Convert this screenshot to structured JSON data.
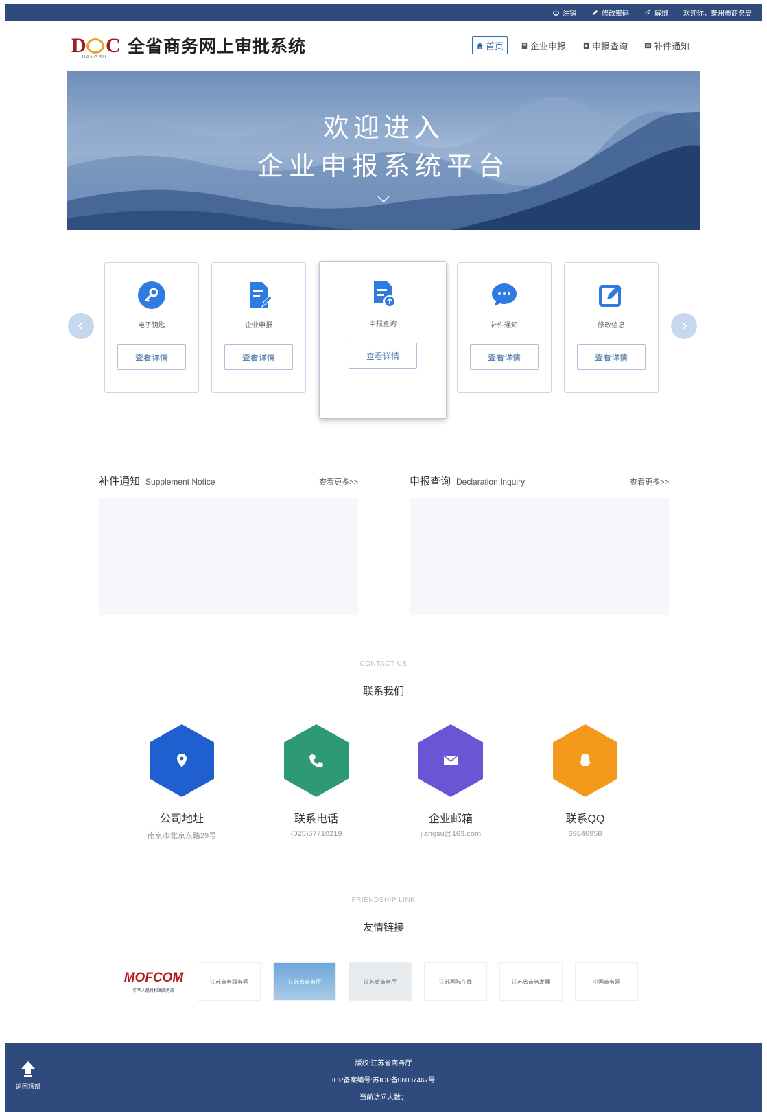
{
  "topbar": {
    "items": [
      {
        "label": "注销",
        "icon": "power-icon"
      },
      {
        "label": "修改密码",
        "icon": "pencil-icon"
      },
      {
        "label": "解绑",
        "icon": "unlink-icon"
      },
      {
        "label": "欢迎你，泰州市商务局",
        "icon": ""
      }
    ]
  },
  "header": {
    "logo_text": "DOC",
    "logo_sub": "JIANGSU",
    "title": "全省商务网上审批系统",
    "nav": [
      {
        "label": "首页",
        "icon": "home-icon",
        "active": true
      },
      {
        "label": "企业申报",
        "icon": "document-icon",
        "active": false
      },
      {
        "label": "申报查询",
        "icon": "search-document-icon",
        "active": false
      },
      {
        "label": "补件通知",
        "icon": "notice-icon",
        "active": false
      }
    ]
  },
  "banner": {
    "line1": "欢迎进入",
    "line2": "企业申报系统平台"
  },
  "cards": [
    {
      "label": "电子钥匙",
      "button": "查看详情",
      "icon": "key-icon"
    },
    {
      "label": "企业申报",
      "button": "查看详情",
      "icon": "edit-document-icon"
    },
    {
      "label": "申报查询",
      "button": "查看详情",
      "icon": "upload-document-icon"
    },
    {
      "label": "补件通知",
      "button": "查看详情",
      "icon": "chat-icon"
    },
    {
      "label": "修改信息",
      "button": "查看详情",
      "icon": "edit-icon"
    }
  ],
  "panels": [
    {
      "title": "补件通知",
      "subtitle": "Supplement Notice",
      "more": "查看更多>>"
    },
    {
      "title": "申报查询",
      "subtitle": "Declaration Inquiry",
      "more": "查看更多>>"
    }
  ],
  "contact": {
    "en": "CONTACT US",
    "title": "联系我们",
    "items": [
      {
        "title": "公司地址",
        "value": "南京市北京东路29号",
        "color": "#1f5fcf",
        "icon": "location-icon"
      },
      {
        "title": "联系电话",
        "value": "(025)57710219",
        "color": "#2e9a73",
        "icon": "phone-icon"
      },
      {
        "title": "企业邮箱",
        "value": "jiangsu@163.com",
        "color": "#6a55d6",
        "icon": "mail-icon"
      },
      {
        "title": "联系QQ",
        "value": "69846958",
        "color": "#f5991d",
        "icon": "qq-icon"
      }
    ]
  },
  "links": {
    "en": "FRIENDSHIP LINK",
    "title": "友情链接",
    "items": [
      {
        "name": "MOFCOM",
        "sub": "中华人民共和国商务部"
      },
      {
        "name": "江苏商务服务网"
      },
      {
        "name": "江苏省商务厅"
      },
      {
        "name": "江苏省商务厅"
      },
      {
        "name": "江苏国际在线"
      },
      {
        "name": "江苏省商务发展"
      },
      {
        "name": "中国商务网"
      }
    ]
  },
  "footer": {
    "line1": "版权:江苏省商务厅",
    "line2": "ICP备案编号:苏ICP备06007467号",
    "line3": "当前访问人数：",
    "backtop": "返回顶部"
  },
  "colors": {
    "brand_dark": "#2f4a7d",
    "link_blue": "#2f6db5"
  }
}
